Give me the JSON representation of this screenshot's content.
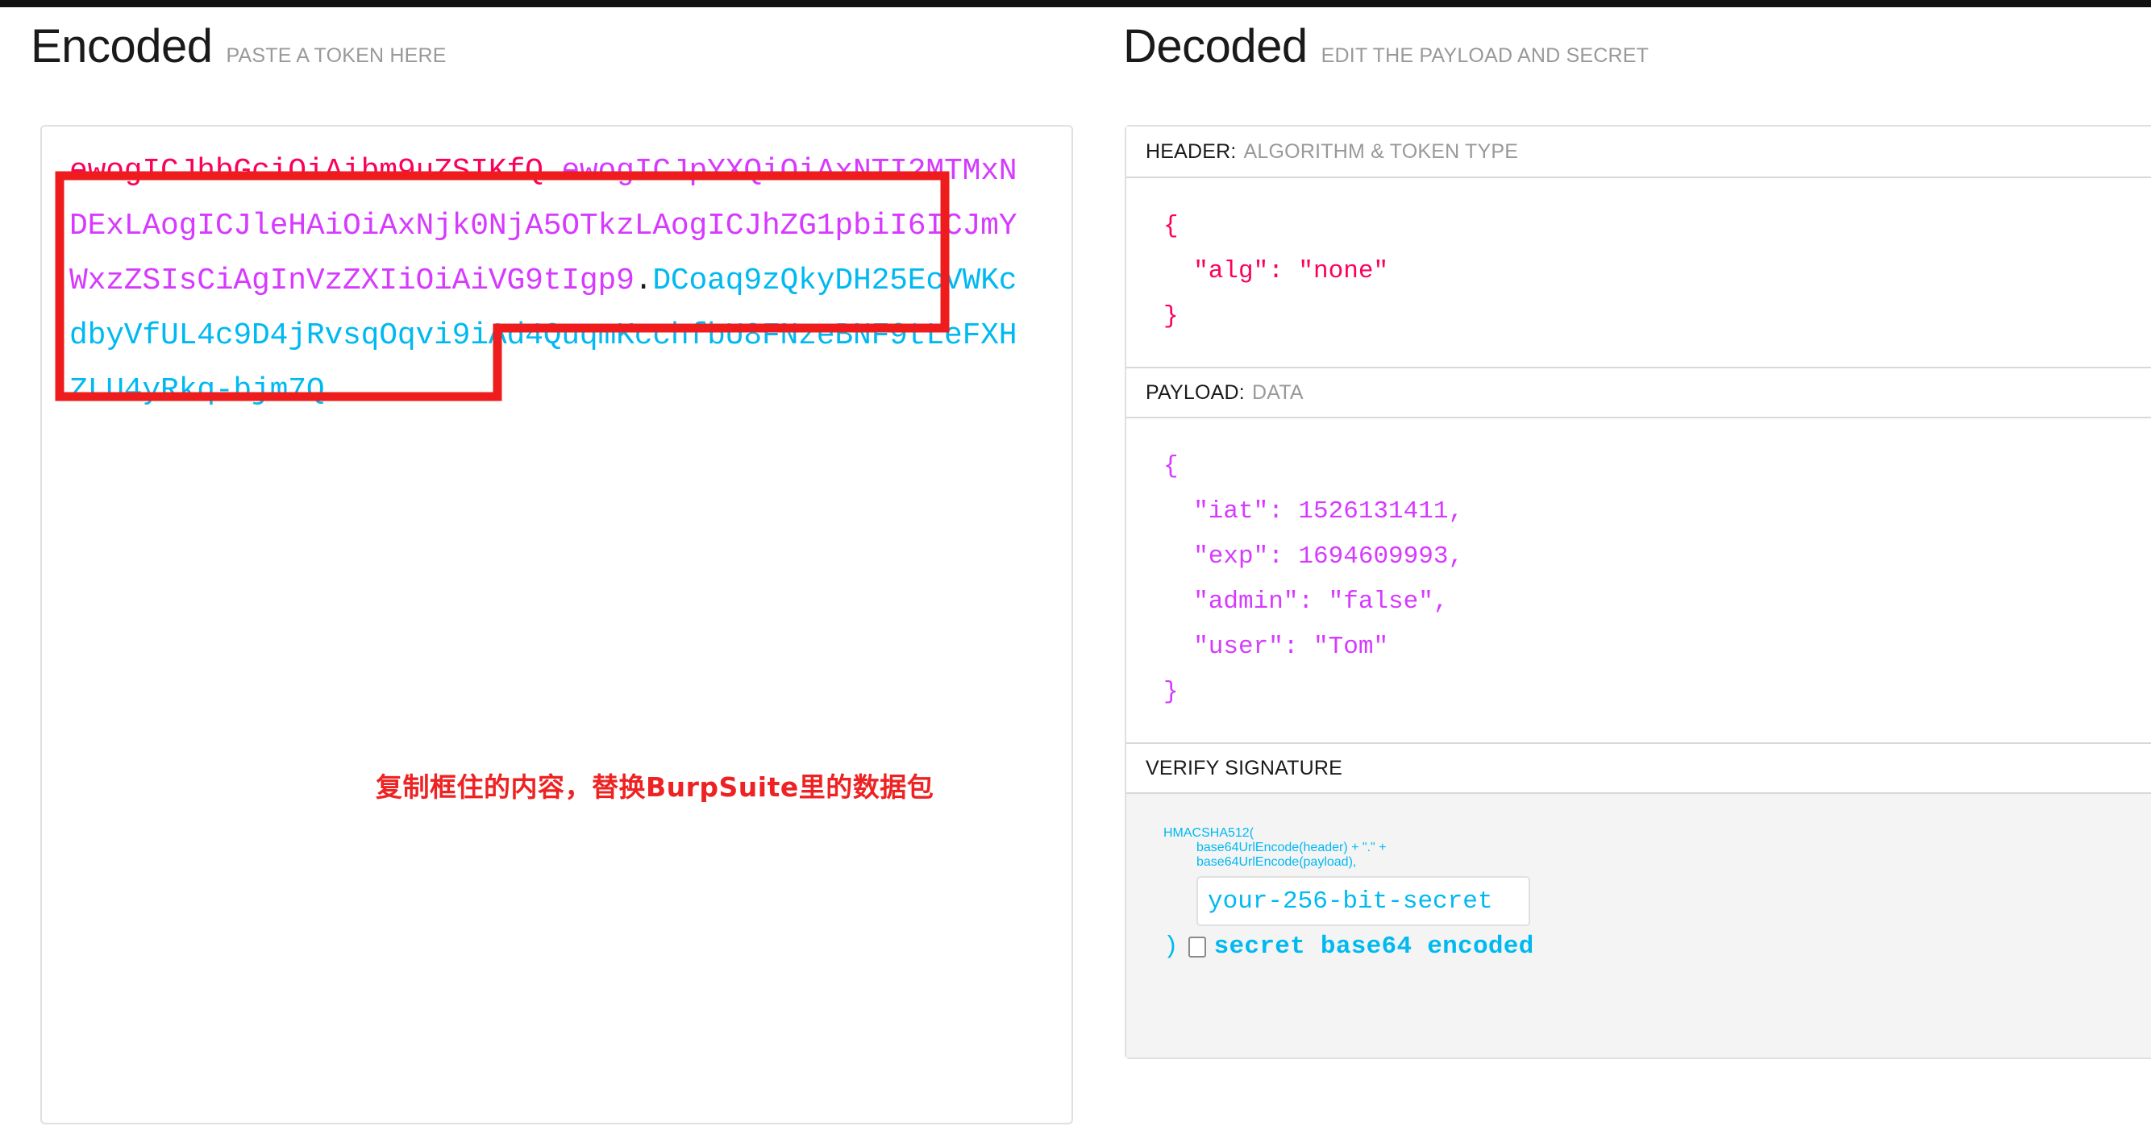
{
  "topbar": {
    "color": "#121212"
  },
  "encoded": {
    "title": "Encoded",
    "subtitle": "PASTE A TOKEN HERE",
    "token": {
      "header": "ewogICJhbGciOiAibm9uZSIKfQ",
      "separator1": ".",
      "payload": "ewogICJpYXQiOiAxNTI2MTMxNDExLAogICJleHAiOiAxNjk0NjA5OTkzLAogICJhZG1pbiI6ICJmYWxzZSIsCiAgInVzZXIiOiAiVG9tIgp9",
      "separator2": ".",
      "signature": "DCoaq9zQkyDH25EcVWKcdbyVfUL4c9D4jRvsqOqvi9iAd4QuqmKcchfbU8FNzeBNF9tLeFXHZLU4yRkq-bjm7Q"
    },
    "annotation": {
      "text": "复制框住的内容，替换BurpSuite里的数据包",
      "color": "#ee2222",
      "box_color": "#ee1c1c"
    },
    "colors": {
      "header": "#fb015b",
      "payload": "#d63aff",
      "signature": "#00b9f1",
      "dot": "#1a1a1a"
    }
  },
  "decoded": {
    "title": "Decoded",
    "subtitle": "EDIT THE PAYLOAD AND SECRET",
    "sections": {
      "header": {
        "label": "HEADER:",
        "hint": "ALGORITHM & TOKEN TYPE",
        "code": "{\n  \"alg\": \"none\"\n}"
      },
      "payload": {
        "label": "PAYLOAD:",
        "hint": "DATA",
        "code": "{\n  \"iat\": 1526131411,\n  \"exp\": 1694609993,\n  \"admin\": \"false\",\n  \"user\": \"Tom\"\n}"
      },
      "signature": {
        "label": "VERIFY SIGNATURE",
        "hint": "",
        "line1": "HMACSHA512(",
        "line2": "base64UrlEncode(header) + \".\" +",
        "line3": "base64UrlEncode(payload),",
        "secret_placeholder": "your-256-bit-secret",
        "secret_value": "",
        "close_paren": ")",
        "checkbox_label": "secret base64 encoded",
        "checkbox_checked": false
      }
    }
  }
}
